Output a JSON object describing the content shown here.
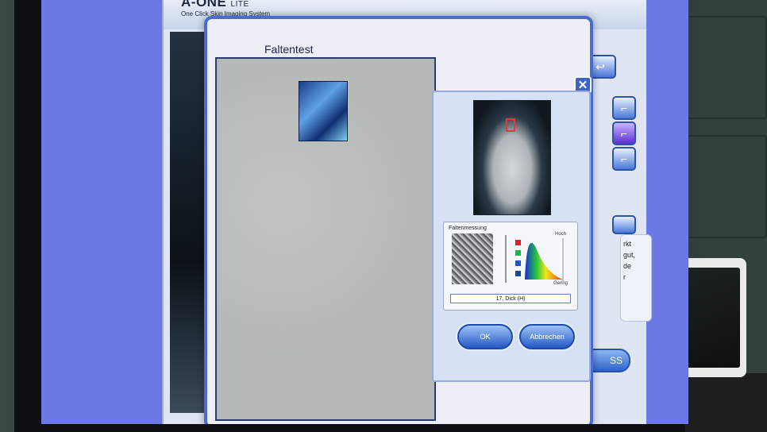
{
  "app": {
    "name": "A-ONE",
    "edition": "LITE",
    "subtitle": "One Click Skin Imaging System"
  },
  "dialog": {
    "title": "Faltentest",
    "close_symbol": "✕"
  },
  "measurement": {
    "label": "Faltenmessung",
    "scale_high": "Hoch",
    "scale_low": "Gering",
    "result": "17, Dick (H)",
    "legend_colors": [
      "#e02020",
      "#1fb34a",
      "#1f56c9",
      "#124a9e"
    ]
  },
  "buttons": {
    "ok": "OK",
    "cancel": "Abbrechen"
  },
  "side_note": {
    "lines": [
      "rkt",
      "gut,",
      "de",
      "r"
    ]
  },
  "background_button": {
    "label": "SS"
  },
  "colors": {
    "accent": "#4b6bd0",
    "screen": "#6c78e3"
  }
}
